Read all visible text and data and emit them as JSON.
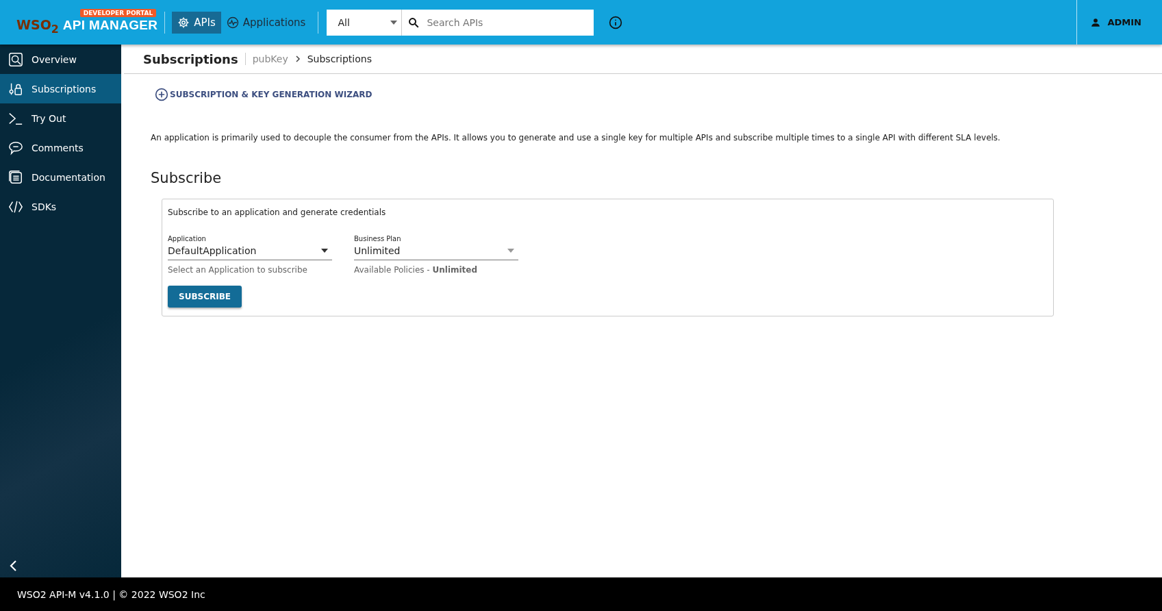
{
  "header": {
    "logo": "WSO$_{2}$",
    "product": "API MANAGER",
    "badge": "DEVELOPER PORTAL",
    "nav": [
      {
        "label": "APIs",
        "selected": true
      },
      {
        "label": "Applications",
        "selected": false
      }
    ],
    "search_scope": "All",
    "search": {
      "placeholder": "Search APIs"
    },
    "user": "ADMIN"
  },
  "sidebar": {
    "items": [
      {
        "label": "Overview",
        "selected": false
      },
      {
        "label": "Subscriptions",
        "selected": true
      },
      {
        "label": "Try Out",
        "selected": false
      },
      {
        "label": "Comments",
        "selected": false
      },
      {
        "label": "Documentation",
        "selected": false
      },
      {
        "label": "SDKs",
        "selected": false
      }
    ]
  },
  "page": {
    "title": "Subscriptions",
    "breadcrumbs": [
      "pubKey",
      "Subscriptions"
    ],
    "wizard_link": "SUBSCRIPTION & KEY GENERATION WIZARD",
    "description": "An application is primarily used to decouple the consumer from the APIs. It allows you to generate and use a single key for multiple APIs and subscribe multiple times to a single API with different SLA levels.",
    "section_title": "Subscribe",
    "card": {
      "intro": "Subscribe to an application and generate credentials",
      "fields": [
        {
          "label": "Application",
          "value": "DefaultApplication",
          "helper": "Select an Application to subscribe",
          "disabled": false
        },
        {
          "label": "Business Plan",
          "value": "Unlimited",
          "helper": "Available Policies - **Unlimited**",
          "disabled": true
        }
      ],
      "button": "SUBSCRIBE"
    }
  },
  "footer": "WSO2 API-M v4.1.0 | © 2022 WSO2 Inc"
}
